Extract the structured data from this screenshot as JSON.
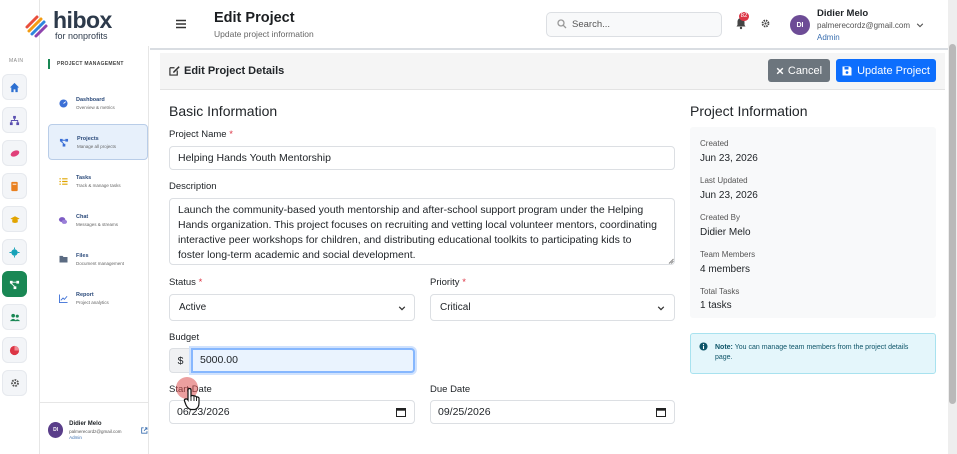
{
  "app": {
    "logo_main": "hibox",
    "logo_sub": "for nonprofits"
  },
  "rail": {
    "section_label": "MAIN"
  },
  "sidebar": {
    "section": "PROJECT MANAGEMENT",
    "items": [
      {
        "title": "Dashboard",
        "sub": "Overview & metrics"
      },
      {
        "title": "Projects",
        "sub": "Manage all projects"
      },
      {
        "title": "Tasks",
        "sub": "Track & manage tasks"
      },
      {
        "title": "Chat",
        "sub": "Messages & streams"
      },
      {
        "title": "Files",
        "sub": "Document management"
      },
      {
        "title": "Report",
        "sub": "Project analytics"
      }
    ],
    "user": {
      "initials": "DI",
      "name": "Didier Melo",
      "email": "palmerecordz@gmail.com",
      "role": "Admin"
    }
  },
  "header": {
    "title": "Edit Project",
    "subtitle": "Update project information",
    "search_placeholder": "Search...",
    "notif_count": "82",
    "user": {
      "initials": "DI",
      "name": "Didier Melo",
      "email": "palmerecordz@gmail.com",
      "role": "Admin"
    }
  },
  "card": {
    "title": "Edit Project Details",
    "cancel_label": "Cancel",
    "update_label": "Update Project"
  },
  "form": {
    "section": "Basic Information",
    "name_label": "Project Name",
    "name_value": "Helping Hands Youth Mentorship",
    "desc_label": "Description",
    "desc_lines": [
      "Launch the community-based youth mentorship and after-school support program under the Helping",
      "Hands organization. This project focuses on recruiting and vetting local volunteer mentors, coordinating",
      "interactive peer workshops for children, and distributing educational toolkits to participating kids to",
      "foster long-term academic and social development."
    ],
    "status_label": "Status",
    "status_value": "Active",
    "priority_label": "Priority",
    "priority_value": "Critical",
    "budget_label": "Budget",
    "budget_prefix": "$",
    "budget_value": "5000.00",
    "start_label": "Start Date",
    "start_value": "06/23/2026",
    "due_label": "Due Date",
    "due_value": "09/25/2026",
    "required_mark": "*"
  },
  "info": {
    "section": "Project Information",
    "created_label": "Created",
    "created_value": "Jun 23, 2026",
    "updated_label": "Last Updated",
    "updated_value": "Jun 23, 2026",
    "created_by_label": "Created By",
    "created_by_value": "Didier Melo",
    "members_label": "Team Members",
    "members_value": "4 members",
    "tasks_label": "Total Tasks",
    "tasks_value": "1 tasks",
    "note_bold": "Note:",
    "note_text": " You can manage team members from the project details page."
  },
  "colors": {
    "primary": "#0d6efd",
    "secondary": "#6c757d",
    "accent": "#198754",
    "danger": "#dc3545"
  }
}
